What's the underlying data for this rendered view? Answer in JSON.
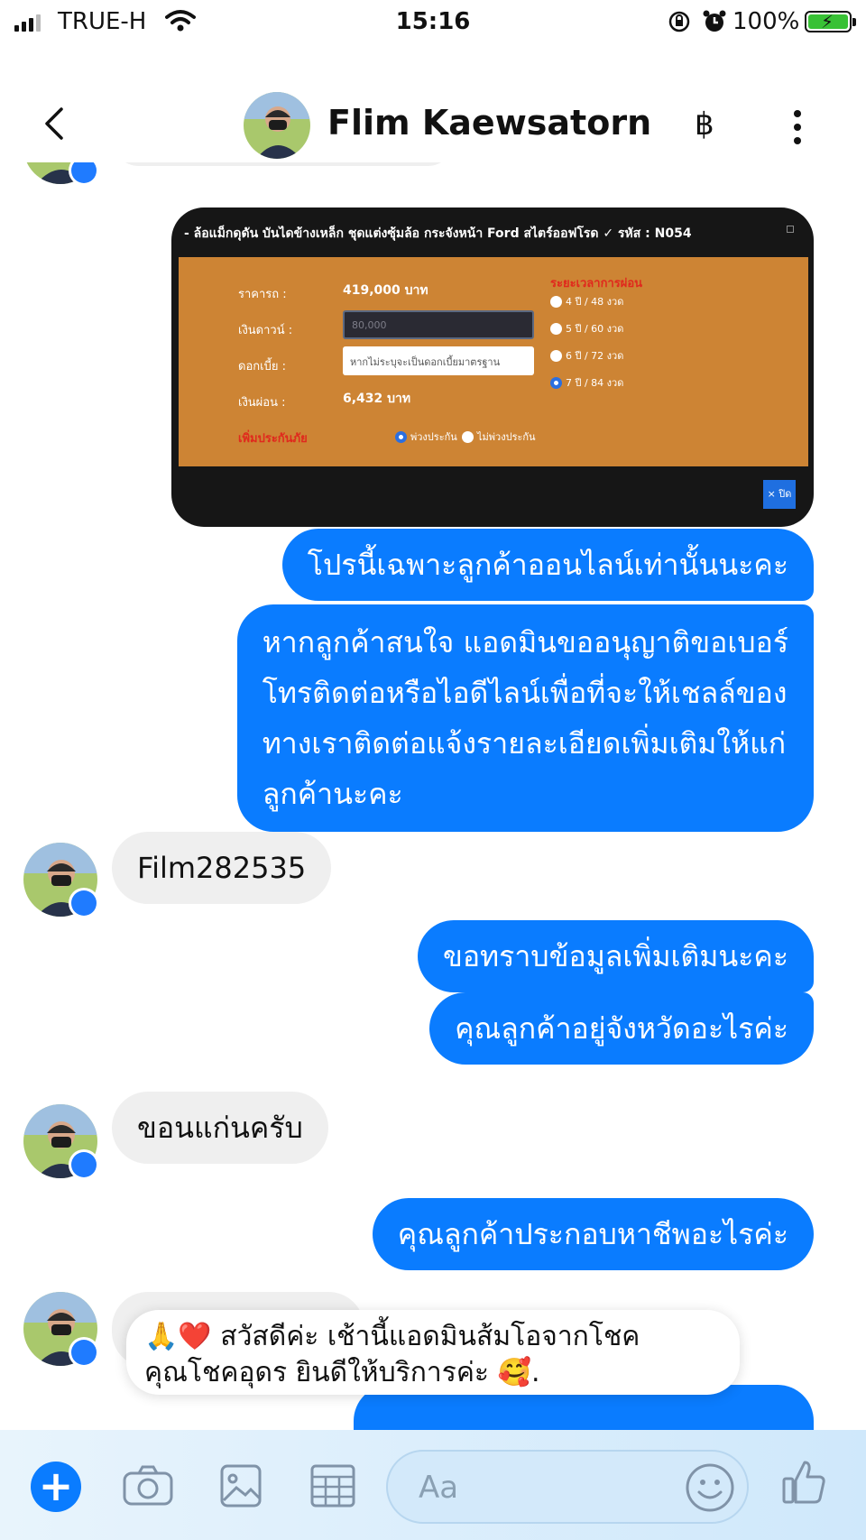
{
  "status_bar": {
    "carrier": "TRUE-H",
    "time": "15:16",
    "battery": "100%"
  },
  "header": {
    "contact_name": "Flim Kaewsatorn",
    "currency_symbol": "฿"
  },
  "image_message": {
    "title": "- ล้อแม็กดุดัน บันไดข้างเหล็ก ชุดแต่งซุ้มล้อ กระจังหน้า Ford สไตร์ออฟโรด ✓ รหัส : N054",
    "price_label": "ราคารถ :",
    "price_value": "419,000 บาท",
    "down_label": "เงินดาวน์ :",
    "down_value": "80,000",
    "interest_label": "ดอกเบี้ย :",
    "interest_placeholder": "หากไม่ระบุจะเป็นดอกเบี้ยมาตรฐาน",
    "installment_label": "เงินผ่อน :",
    "installment_value": "6,432 บาท",
    "insurance_label": "เพิ่มประกันภัย",
    "insurance_options": [
      "พ่วงประกัน",
      "ไม่พ่วงประกัน"
    ],
    "term_title": "ระยะเวลาการผ่อน",
    "term_options": [
      "4 ปี / 48 งวด",
      "5 ปี / 60 งวด",
      "6 ปี / 72 งวด",
      "7 ปี / 84 งวด"
    ],
    "close_label": "× ปิด"
  },
  "messages": {
    "m1": "โปรนี้เฉพาะลูกค้าออนไลน์เท่านั้นนะคะ",
    "m2_lines": [
      "หากลูกค้าสนใจ แอดมินขออนุญาติขอเบอร์",
      "โทรติดต่อหรือไอดีไลน์เพื่อที่จะให้เชลล์ของ",
      "ทางเราติดต่อแจ้งรายละเอียดเพิ่มเติมให้แก่",
      "ลูกค้านะคะ"
    ],
    "m3": "Film282535",
    "m4": "ขอทราบข้อมูลเพิ่มเติมนะคะ",
    "m5": "คุณลูกค้าอยู่จังหวัดอะไรค่ะ",
    "m6": "ขอนแก่นครับ",
    "m7": "คุณลูกค้าประกอบหาชีพอะไรค่ะ"
  },
  "toast": {
    "line1": "สวัสดีค่ะ เช้านี้แอดมินส้มโอจากโชค",
    "line2": "คุณโชคอุดร ยินดีให้บริการค่ะ",
    "emoji_start": "🙏❤️",
    "emoji_end": "🥰."
  },
  "composer": {
    "placeholder": "Aa"
  },
  "colors": {
    "outgoing_bubble": "#0a7cff",
    "incoming_bubble": "#efefef"
  },
  "icons": [
    "signal-icon",
    "wifi-icon",
    "rotation-lock-icon",
    "alarm-icon",
    "battery-icon",
    "back-icon",
    "more-icon",
    "plus-icon",
    "camera-icon",
    "gallery-icon",
    "table-icon",
    "smile-icon",
    "like-icon"
  ]
}
